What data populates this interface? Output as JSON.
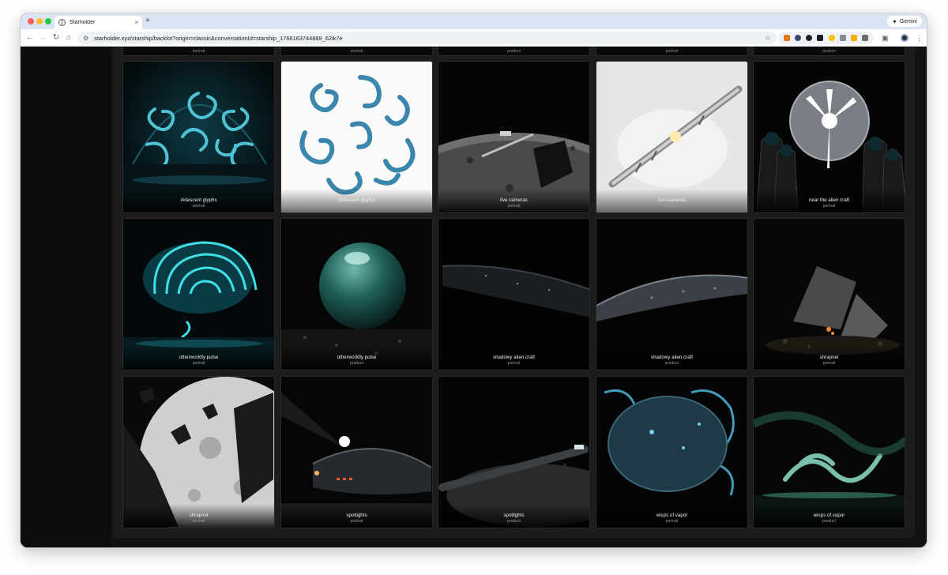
{
  "browser": {
    "tab_title": "Starholder",
    "tab_close": "×",
    "new_tab": "+",
    "gemini_label": "Gemini",
    "url": "starholder.xyz/starship/backlot?origin=classic&conversationId=starship_1766163744889_62ik7e"
  },
  "gallery": {
    "previous_row": [
      {
        "subtitle": "portrait"
      },
      {
        "subtitle": "portrait"
      },
      {
        "subtitle": "product"
      },
      {
        "subtitle": "portrait"
      },
      {
        "subtitle": "product"
      }
    ],
    "cards": [
      {
        "title": "iridescent glyphs",
        "subtitle": "portrait",
        "accent": "#3fb7c9"
      },
      {
        "title": "iridescent glyphs",
        "subtitle": "product",
        "accent": "#2e7fa8"
      },
      {
        "title": "live cameras",
        "subtitle": "portrait",
        "accent": "#9a9a9a"
      },
      {
        "title": "live cameras",
        "subtitle": "product",
        "accent": "#c8c8c8"
      },
      {
        "title": "near the alien craft",
        "subtitle": "portrait",
        "accent": "#ffffff"
      },
      {
        "title": "otherworldly pulse",
        "subtitle": "portrait",
        "accent": "#3fe0e8"
      },
      {
        "title": "otherworldly pulse",
        "subtitle": "product",
        "accent": "#4fa89a"
      },
      {
        "title": "shadowy alien craft",
        "subtitle": "portrait",
        "accent": "#5a6470"
      },
      {
        "title": "shadowy alien craft",
        "subtitle": "product",
        "accent": "#6a7580"
      },
      {
        "title": "shrapnel",
        "subtitle": "portrait",
        "accent": "#ff8a2a"
      },
      {
        "title": "shrapnel",
        "subtitle": "portrait",
        "accent": "#dcdcdc"
      },
      {
        "title": "spotlights",
        "subtitle": "portrait",
        "accent": "#ff5a2a"
      },
      {
        "title": "spotlights",
        "subtitle": "product",
        "accent": "#b0c0c8"
      },
      {
        "title": "wisps of vapor",
        "subtitle": "portrait",
        "accent": "#4fb8d8"
      },
      {
        "title": "wisps of vapor",
        "subtitle": "product",
        "accent": "#8fe0c8"
      }
    ]
  }
}
